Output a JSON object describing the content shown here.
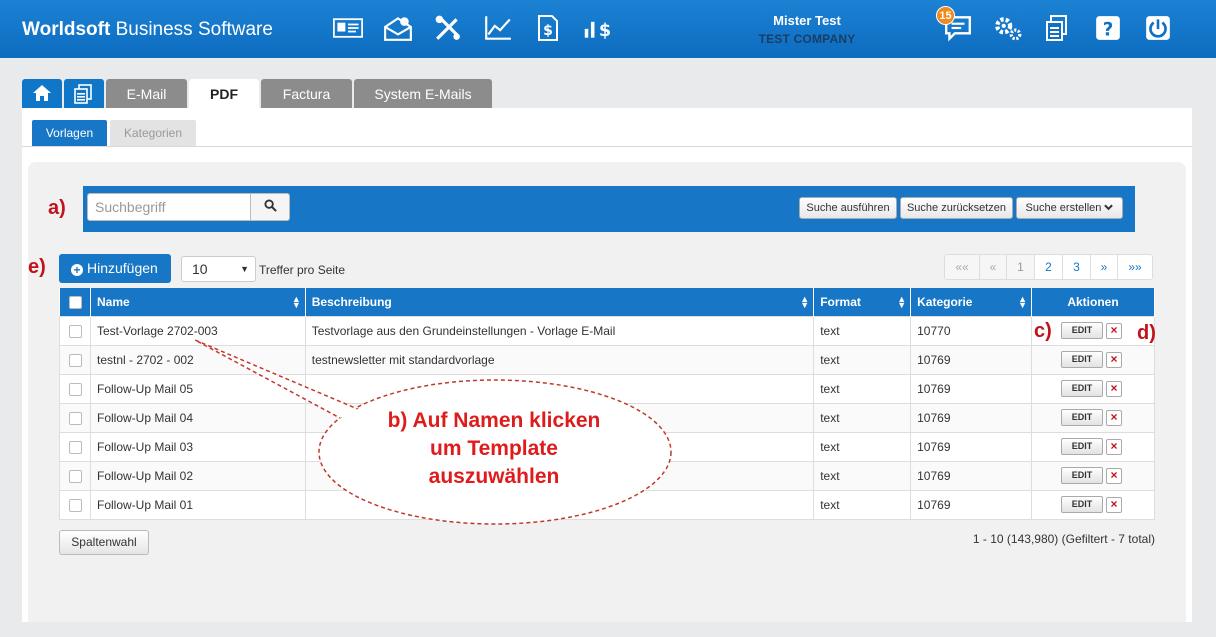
{
  "app": {
    "brand_bold": "Worldsoft",
    "brand_rest": " Business Software",
    "user_name": "Mister Test",
    "company": "TEST COMPANY",
    "notification_count": "15",
    "header_icons": [
      "contact-card-icon",
      "mail-settings-icon",
      "tools-icon",
      "stats-chart-icon",
      "invoice-icon",
      "revenue-chart-icon",
      "chat-icon",
      "gears-icon",
      "documents-icon",
      "help-icon",
      "power-icon"
    ]
  },
  "tabs": {
    "email": "E-Mail",
    "pdf": "PDF",
    "factura": "Factura",
    "system": "System E-Mails"
  },
  "subtabs": {
    "vorlagen": "Vorlagen",
    "kategorien": "Kategorien"
  },
  "search": {
    "placeholder": "Suchbegriff",
    "run": "Suche ausführen",
    "reset": "Suche zurücksetzen",
    "create": "Suche erstellen"
  },
  "annotations": {
    "a": "a)",
    "c": "c)",
    "d": "d)",
    "e": "e)",
    "callout_line1": "b) Auf Namen klicken",
    "callout_line2": "um Template",
    "callout_line3": "auszuwählen"
  },
  "toolbar": {
    "add": "Hinzufügen",
    "per_page": "10",
    "per_page_label": "Treffer pro Seite"
  },
  "pager": {
    "first": "««",
    "prev": "«",
    "p1": "1",
    "p2": "2",
    "p3": "3",
    "next": "»",
    "last": "»»"
  },
  "table": {
    "headers": {
      "name": "Name",
      "beschreibung": "Beschreibung",
      "format": "Format",
      "kategorie": "Kategorie",
      "aktionen": "Aktionen"
    },
    "edit_label": "EDIT",
    "delete_label": "×",
    "rows": [
      {
        "name": "Test-Vorlage 2702-003",
        "desc": "Testvorlage aus den Grundeinstellungen - Vorlage E-Mail",
        "format": "text",
        "kategorie": "10770"
      },
      {
        "name": "testnl - 2702 - 002",
        "desc": "testnewsletter mit standardvorlage",
        "format": "text",
        "kategorie": "10769"
      },
      {
        "name": "Follow-Up Mail 05",
        "desc": "",
        "format": "text",
        "kategorie": "10769"
      },
      {
        "name": "Follow-Up Mail 04",
        "desc": "",
        "format": "text",
        "kategorie": "10769"
      },
      {
        "name": "Follow-Up Mail 03",
        "desc": "",
        "format": "text",
        "kategorie": "10769"
      },
      {
        "name": "Follow-Up Mail 02",
        "desc": "",
        "format": "text",
        "kategorie": "10769"
      },
      {
        "name": "Follow-Up Mail 01",
        "desc": "",
        "format": "text",
        "kategorie": "10769"
      }
    ]
  },
  "footer": {
    "columns_button": "Spaltenwahl",
    "total": "1 - 10 (143,980) (Gefiltert - 7 total)"
  }
}
